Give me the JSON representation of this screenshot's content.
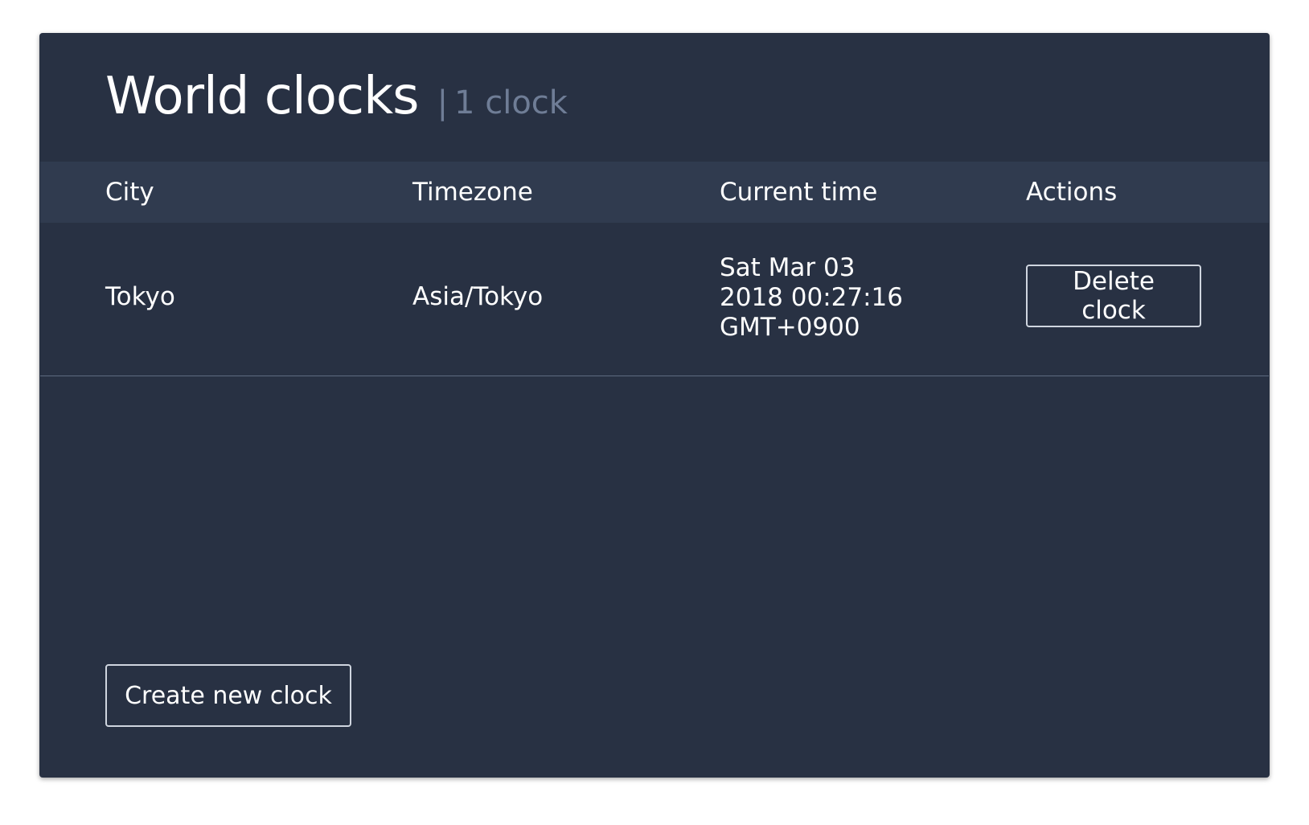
{
  "header": {
    "title": "World clocks",
    "separator": "|",
    "count_label": "1 clock"
  },
  "table": {
    "columns": [
      "City",
      "Timezone",
      "Current time",
      "Actions"
    ],
    "rows": [
      {
        "city": "Tokyo",
        "timezone": "Asia/Tokyo",
        "current_time": "Sat Mar 03 2018 00:27:16 GMT+0900",
        "action_label": "Delete clock"
      }
    ]
  },
  "footer": {
    "create_label": "Create new clock"
  },
  "colors": {
    "panel_bg": "#283143",
    "header_row_bg": "#303b4f",
    "muted_text": "#6f7d96",
    "text": "#ffffff",
    "button_border": "#cfd5df"
  }
}
